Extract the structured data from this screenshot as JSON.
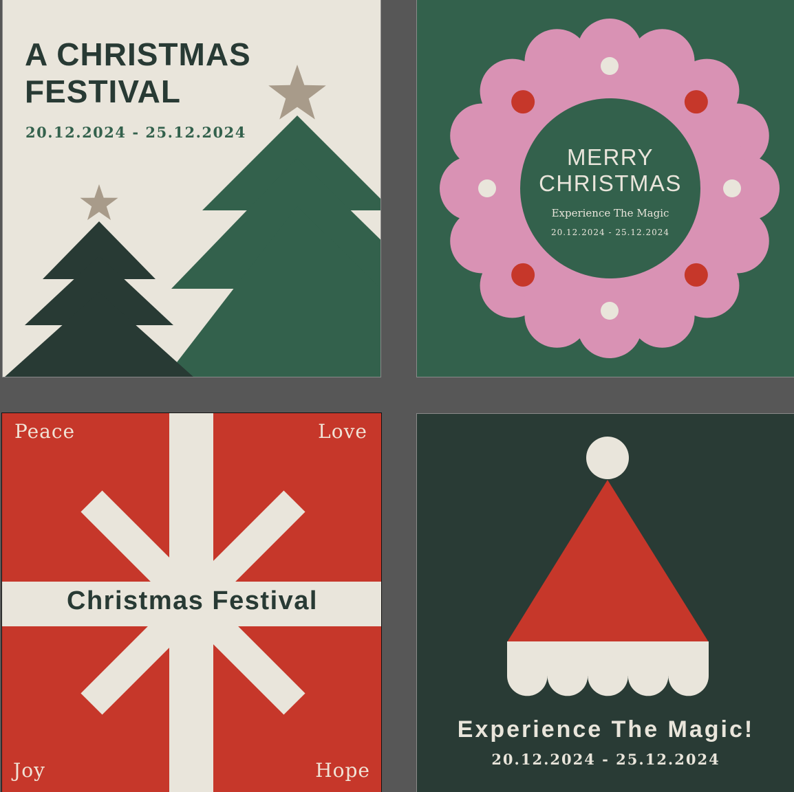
{
  "colors": {
    "cream": "#e9e5db",
    "forest": "#33614c",
    "dark_green": "#283a34",
    "red": "#c6372a",
    "pink": "#d992b4",
    "star": "#a89b8a",
    "backdrop": "#575757"
  },
  "festival_card": {
    "title_line1": "A CHRISTMAS",
    "title_line2": "FESTIVAL",
    "dates": "20.12.2024 - 25.12.2024"
  },
  "wreath_card": {
    "title_line1": "MERRY",
    "title_line2": "CHRISTMAS",
    "subtitle": "Experience The Magic",
    "dates": "20.12.2024 - 25.12.2024"
  },
  "gift_card": {
    "top_left": "Peace",
    "top_right": "Love",
    "bottom_left": "Joy",
    "bottom_right": "Hope",
    "title": "Christmas Festival"
  },
  "hat_card": {
    "tagline": "Experience The Magic!",
    "dates": "20.12.2024 - 25.12.2024"
  },
  "icons": [
    "star-icon",
    "christmas-tree-icon",
    "wreath-icon",
    "snowflake-icon",
    "santa-hat-icon"
  ]
}
